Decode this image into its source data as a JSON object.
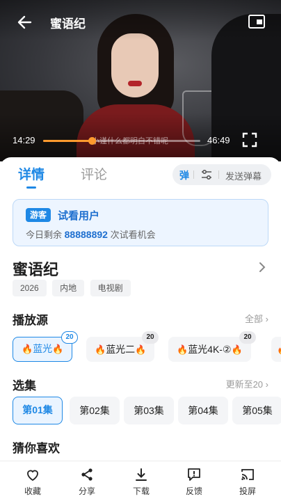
{
  "player": {
    "title": "蜜语纪",
    "current_time": "14:29",
    "total_time": "46:49",
    "progress": 0.31,
    "subtitle_text": "小谨什么都明白不错呢"
  },
  "tabs": {
    "detail": "详情",
    "comment": "评论"
  },
  "danmu": {
    "toggle_label": "弹",
    "send_label": "发送弹幕"
  },
  "guest": {
    "badge": "游客",
    "title": "试看用户",
    "desc_prefix": "今日剩余",
    "count": "88888892",
    "desc_suffix": "次试看机会"
  },
  "show": {
    "title": "蜜语纪",
    "tags": [
      "2026",
      "内地",
      "电视剧"
    ]
  },
  "sources_section": {
    "title": "播放源",
    "more": "全部"
  },
  "sources": [
    {
      "label": "蓝光",
      "badge": "20",
      "active": true
    },
    {
      "label": "蓝光二",
      "badge": "20",
      "active": false
    },
    {
      "label": "蓝光4K-②",
      "badge": "20",
      "active": false
    }
  ],
  "episodes_section": {
    "title": "选集",
    "more": "更新至20"
  },
  "episodes": [
    "第01集",
    "第02集",
    "第03集",
    "第04集",
    "第05集"
  ],
  "recommend_section": {
    "title": "猜你喜欢"
  },
  "bottom_bar": {
    "favorite": "收藏",
    "share": "分享",
    "download": "下载",
    "feedback": "反馈",
    "cast": "投屏"
  },
  "colors": {
    "accent": "#1e88e5",
    "progress": "#ff9a2e",
    "flame": "#ff6a00"
  }
}
